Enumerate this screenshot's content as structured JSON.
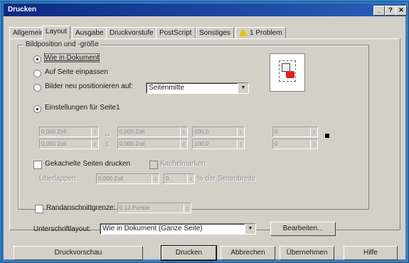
{
  "window": {
    "title": "Drucken"
  },
  "tabs": [
    {
      "label": "Allgemein"
    },
    {
      "label": "Layout"
    },
    {
      "label": "Ausgabe"
    },
    {
      "label": "Druckvorstufe"
    },
    {
      "label": "PostScript"
    },
    {
      "label": "Sonstiges"
    },
    {
      "label": "1 Problem"
    }
  ],
  "group": {
    "title": "Bildposition und -größe",
    "options": [
      {
        "label": "Wie in Dokument",
        "selected": true
      },
      {
        "label": "Auf Seite einpassen",
        "selected": false
      },
      {
        "label": "Bilder neu positionieren auf:",
        "selected": false
      },
      {
        "label": "Einstellungen für Seite1",
        "selected": true
      }
    ],
    "position_select": "Seitenmitte",
    "fields": [
      {
        "value": "0,000 Zoll"
      },
      {
        "value": "0,000 Zoll"
      },
      {
        "value": "0,000 Zoll"
      },
      {
        "value": "0,000 Zoll"
      },
      {
        "value": "100,0"
      },
      {
        "value": "100,0"
      },
      {
        "value": "0"
      },
      {
        "value": "0"
      }
    ],
    "tile_label": "Gekachelte Seiten drucken",
    "tile_marks": "Kachelmarken",
    "overlap_label": "Überlappen:",
    "overlap_value": "0,000 Zoll",
    "overlap_pct": "0",
    "overlap_pct_suffix": "% der Seitenbreite"
  },
  "bleed": {
    "label": "Randanschnittgrenze:",
    "value": "0,13 Punkte"
  },
  "signature": {
    "label": "Unterschriftlayout:",
    "value": "Wie in Dokument (Ganze Seite)",
    "edit_button": "Bearbeiten..."
  },
  "footer": {
    "preview": "Druckvorschau",
    "print": "Drucken",
    "cancel": "Abbrechen",
    "apply": "Übernehmen",
    "help": "Hilfe"
  }
}
